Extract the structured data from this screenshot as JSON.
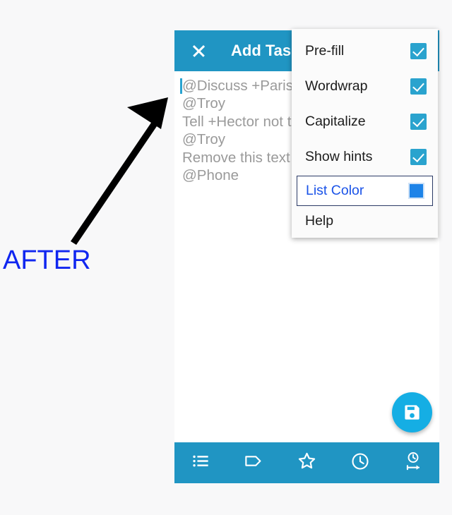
{
  "annotation": {
    "label": "AFTER",
    "label_color": "#1026f0",
    "arrow_color": "#000000"
  },
  "app": {
    "toolbar": {
      "close_icon": "close-icon",
      "title": "Add Task",
      "background": "#2095c3"
    },
    "note": {
      "cursor_visible": true,
      "lines": [
        "@Discuss +Paris",
        "@Troy",
        "Tell +Hector not to",
        "@Troy",
        "Remove this text",
        "@Phone"
      ],
      "hint_color": "#9a9a9a"
    },
    "fab": {
      "icon": "save-floppy-icon",
      "background": "#15aee4"
    },
    "bottom_bar": {
      "background": "#2095c3",
      "items": [
        {
          "icon": "list-icon",
          "name": "lists"
        },
        {
          "icon": "tag-icon",
          "name": "tags"
        },
        {
          "icon": "star-icon",
          "name": "star"
        },
        {
          "icon": "clock-icon",
          "name": "reminder"
        },
        {
          "icon": "clock-duration-icon",
          "name": "duration"
        }
      ]
    }
  },
  "options_menu": {
    "items": [
      {
        "label": "Pre-fill",
        "control": "checkbox",
        "checked": true
      },
      {
        "label": "Wordwrap",
        "control": "checkbox",
        "checked": true
      },
      {
        "label": "Capitalize",
        "control": "checkbox",
        "checked": true
      },
      {
        "label": "Show hints",
        "control": "checkbox",
        "checked": true
      },
      {
        "label": "List Color",
        "control": "color-swatch",
        "swatch_color": "#1d83e8",
        "focused": true
      },
      {
        "label": "Help",
        "control": "none"
      }
    ]
  },
  "colors": {
    "accent": "#2095c3",
    "fab": "#15aee4",
    "checkbox": "#2aa3ce",
    "page_background": "#f8f8f9"
  }
}
